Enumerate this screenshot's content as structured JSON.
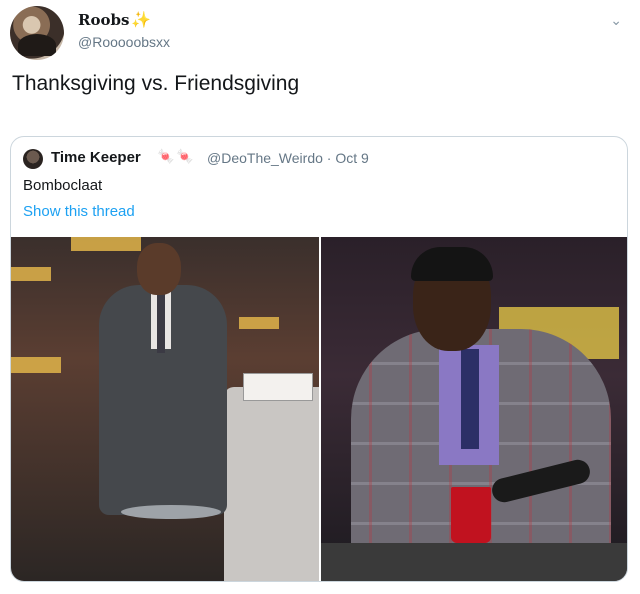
{
  "tweet": {
    "display_name": "Roobs",
    "sparkle": "✨",
    "handle": "@Rooooobsxx",
    "text": "Thanksgiving  vs. Friendsgiving",
    "more_icon": "chevron-down-icon"
  },
  "quoted": {
    "display_name": "Time Keeper",
    "emoji": "🍬🍬",
    "handle_meta": "@DeoThe_Weirdo · Oct 9",
    "text": "Bomboclaat",
    "show_thread": "Show this thread"
  },
  "colors": {
    "link": "#1da1f2",
    "secondary_text": "#657786",
    "border": "#ccd6dd"
  }
}
